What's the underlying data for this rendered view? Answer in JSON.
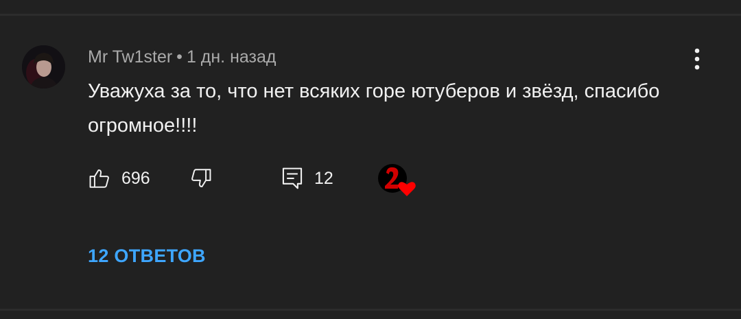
{
  "comment": {
    "author": "Mr Tw1ster",
    "separator": "•",
    "timestamp": "1 дн. назад",
    "text": "Уважуха за то, что нет всяких горе ютуберов и звёзд, спасибо огромное!!!!",
    "likes": "696",
    "reply_count": "12",
    "view_replies_label": "12 ОТВЕТОВ"
  },
  "icons": {
    "like": "thumbs-up-icon",
    "dislike": "thumbs-down-icon",
    "reply": "comment-icon",
    "menu": "more-vertical-icon",
    "creator_heart": "creator-heart-icon"
  },
  "colors": {
    "background": "#212121",
    "text_primary": "#f1f1f1",
    "text_secondary": "#aaaaaa",
    "link": "#3ea6ff",
    "heart": "#ff0000"
  }
}
